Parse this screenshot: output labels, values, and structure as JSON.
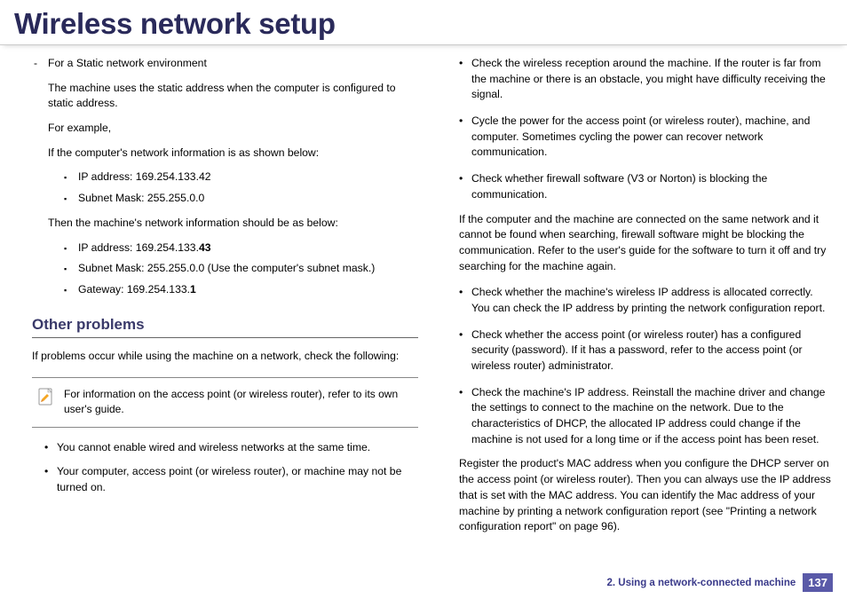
{
  "header": {
    "title": "Wireless network setup"
  },
  "left": {
    "dashItem": "For a Static network environment",
    "p1": "The machine uses the static address when the computer is configured to static address.",
    "p2": "For example,",
    "p3": "If the computer's network information is as shown below:",
    "compList": [
      "IP address: 169.254.133.42",
      "Subnet Mask: 255.255.0.0"
    ],
    "p4": "Then the machine's network information should be as below:",
    "machineList": [
      {
        "prefix": "IP address: 169.254.133.",
        "bold": "43"
      },
      {
        "prefix": "Subnet Mask: 255.255.0.0 (Use the computer's subnet mask.)",
        "bold": ""
      },
      {
        "prefix": "Gateway: 169.254.133.",
        "bold": "1"
      }
    ],
    "sectionTitle": "Other problems",
    "intro": "If problems occur while using the machine on a network, check the following:",
    "note": "For information on the access point (or wireless router), refer to its own user's guide.",
    "bullets": [
      "You cannot enable wired and wireless networks at the same time.",
      "Your computer, access point (or wireless router), or machine may not be turned on."
    ]
  },
  "right": {
    "bullets1": [
      "Check the wireless reception around the machine. If the router is far from the machine or there is an obstacle, you might have difficulty receiving the signal.",
      "Cycle the power for the access point (or wireless router), machine, and computer. Sometimes cycling the power can recover network communication.",
      "Check whether firewall software (V3 or Norton) is blocking the communication."
    ],
    "follow1": "If the computer and the machine are connected on the same network and it cannot be found when searching, firewall software might be blocking the communication. Refer to the user's guide for the software to turn it off and try searching for the machine again.",
    "bullets2": [
      "Check whether the machine's wireless IP address is allocated correctly. You can check the IP address by printing the network configuration report.",
      "Check whether the access point (or wireless router) has a configured security (password). If it has a password, refer to the access point (or wireless router) administrator.",
      "Check the machine's IP address. Reinstall the machine driver and change the settings to connect to the machine on the network. Due to the characteristics of DHCP, the allocated IP address could change if the machine is not used for a long time or if the access point has been reset."
    ],
    "follow2": "Register the product's MAC address when you configure the DHCP server on the access point (or wireless router). Then you can always use the IP address that is set with the MAC address. You can identify the Mac address of your machine by printing a network configuration report (see \"Printing a network configuration report\" on page 96)."
  },
  "footer": {
    "chapter": "2.  Using a network-connected machine",
    "page": "137"
  }
}
